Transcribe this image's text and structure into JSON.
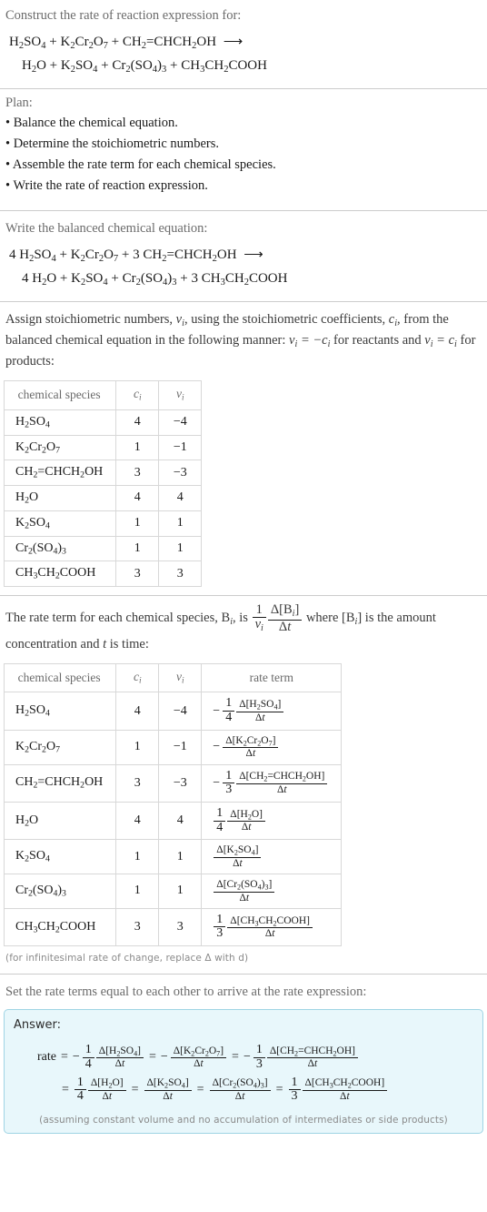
{
  "header": {
    "prompt": "Construct the rate of reaction expression for:",
    "reaction_line1": "H2SO4 + K2Cr2O7 + CH2=CHCH2OH  ⟶",
    "reaction_line2": "H2O + K2SO4 + Cr2(SO4)3 + CH3CH2COOH"
  },
  "plan": {
    "title": "Plan:",
    "steps": [
      "• Balance the chemical equation.",
      "• Determine the stoichiometric numbers.",
      "• Assemble the rate term for each chemical species.",
      "• Write the rate of reaction expression."
    ]
  },
  "balanced": {
    "prompt": "Write the balanced chemical equation:",
    "line1_coeffs": [
      "4",
      "",
      "3"
    ],
    "line2_coeffs": [
      "4",
      "",
      "",
      "3"
    ]
  },
  "stoich": {
    "paragraph_part1": "Assign stoichiometric numbers, ",
    "paragraph_part2": ", using the stoichiometric coefficients, ",
    "paragraph_part3": ", from the balanced chemical equation in the following manner: ",
    "paragraph_part4": " for reactants and ",
    "paragraph_part5": " for products:",
    "columns": [
      "chemical species",
      "c_i",
      "v_i"
    ],
    "rows": [
      {
        "species": "H2SO4",
        "c": "4",
        "v": "-4"
      },
      {
        "species": "K2Cr2O7",
        "c": "1",
        "v": "-1"
      },
      {
        "species": "CH2=CHCH2OH",
        "c": "3",
        "v": "-3"
      },
      {
        "species": "H2O",
        "c": "4",
        "v": "4"
      },
      {
        "species": "K2SO4",
        "c": "1",
        "v": "1"
      },
      {
        "species": "Cr2(SO4)3",
        "c": "1",
        "v": "1"
      },
      {
        "species": "CH3CH2COOH",
        "c": "3",
        "v": "3"
      }
    ]
  },
  "rate_section": {
    "intro_part1": "The rate term for each chemical species, ",
    "intro_part2": ", is ",
    "intro_part3": " where ",
    "intro_part4": " is the amount concentration and ",
    "intro_part5": " is time:",
    "columns": [
      "chemical species",
      "c_i",
      "v_i",
      "rate term"
    ],
    "rows": [
      {
        "species": "H2SO4",
        "c": "4",
        "v": "-4",
        "sign": "-",
        "coeff_num": "1",
        "coeff_den": "4",
        "delta": "Δ[H2SO4]",
        "dt": "Δt"
      },
      {
        "species": "K2Cr2O7",
        "c": "1",
        "v": "-1",
        "sign": "-",
        "coeff_num": "",
        "coeff_den": "",
        "delta": "Δ[K2Cr2O7]",
        "dt": "Δt"
      },
      {
        "species": "CH2=CHCH2OH",
        "c": "3",
        "v": "-3",
        "sign": "-",
        "coeff_num": "1",
        "coeff_den": "3",
        "delta": "Δ[CH2=CHCH2OH]",
        "dt": "Δt"
      },
      {
        "species": "H2O",
        "c": "4",
        "v": "4",
        "sign": "",
        "coeff_num": "1",
        "coeff_den": "4",
        "delta": "Δ[H2O]",
        "dt": "Δt"
      },
      {
        "species": "K2SO4",
        "c": "1",
        "v": "1",
        "sign": "",
        "coeff_num": "",
        "coeff_den": "",
        "delta": "Δ[K2SO4]",
        "dt": "Δt"
      },
      {
        "species": "Cr2(SO4)3",
        "c": "1",
        "v": "1",
        "sign": "",
        "coeff_num": "",
        "coeff_den": "",
        "delta": "Δ[Cr2(SO4)3]",
        "dt": "Δt"
      },
      {
        "species": "CH3CH2COOH",
        "c": "3",
        "v": "3",
        "sign": "",
        "coeff_num": "1",
        "coeff_den": "3",
        "delta": "Δ[CH3CH2COOH]",
        "dt": "Δt"
      }
    ],
    "footnote": "(for infinitesimal rate of change, replace Δ with d)"
  },
  "final": {
    "prompt": "Set the rate terms equal to each other to arrive at the rate expression:",
    "answer_label": "Answer:",
    "rate_word": "rate",
    "assume_note": "(assuming constant volume and no accumulation of intermediates or side products)"
  }
}
